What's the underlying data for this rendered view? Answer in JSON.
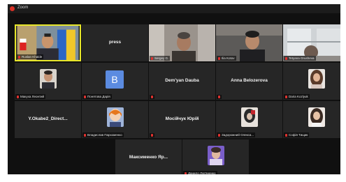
{
  "app": {
    "title": "Zoom"
  },
  "participants": [
    {
      "name": "Ruslan Khalde",
      "type": "video-man-flags"
    },
    {
      "name": "press",
      "type": "name-only"
    },
    {
      "name": "Sergey G.",
      "type": "video-man-room"
    },
    {
      "name": "Ilia Kotov",
      "type": "video-man-dark"
    },
    {
      "name": "Tetyana Grusheva",
      "type": "video-window"
    },
    {
      "name": "Макуха Леонтий",
      "type": "photo-man"
    },
    {
      "name": "Понятова Дарія",
      "type": "letter",
      "letter": "B"
    },
    {
      "name": "Dem'yan Dauba",
      "type": "name-only"
    },
    {
      "name": "Anna Belozerova",
      "type": "name-only"
    },
    {
      "name": "Daria Kozlyuk",
      "type": "photo-woman"
    },
    {
      "name": "Y.Okabe2_Direct...",
      "type": "name-only"
    },
    {
      "name": "Владислав Пархоменко",
      "type": "photo-anime"
    },
    {
      "name": "Мосійчук Юрій",
      "type": "name-only"
    },
    {
      "name": "Задорожний Олекса...",
      "type": "photo-art"
    },
    {
      "name": "Софія Тищик",
      "type": "photo-woman2"
    },
    {
      "name": "Максименко Яр...",
      "type": "name-only"
    },
    {
      "name": "Данило Лук'яненко",
      "type": "photo-purple"
    }
  ],
  "colors": {
    "active_border": "#e7e62a",
    "tile_bg": "#262626",
    "muted_icon": "#e0322f"
  }
}
